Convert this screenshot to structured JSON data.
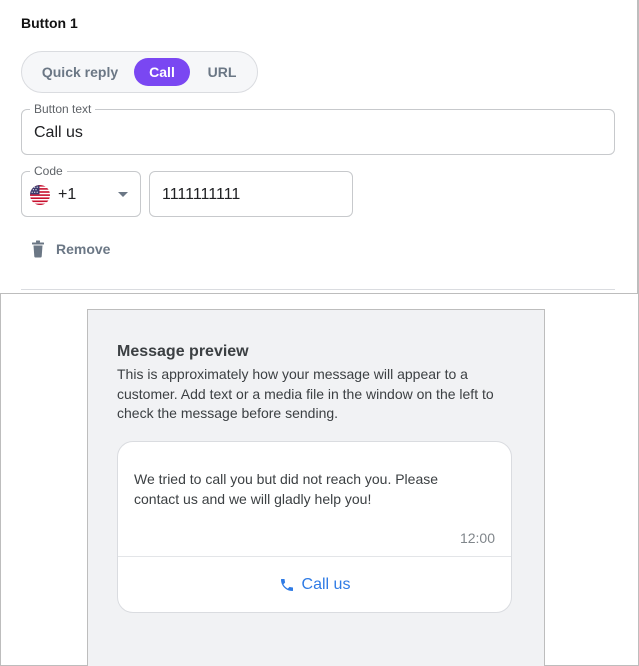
{
  "editor": {
    "section_title": "Button 1",
    "button_types": [
      {
        "label": "Quick reply",
        "selected": false
      },
      {
        "label": "Call",
        "selected": true
      },
      {
        "label": "URL",
        "selected": false
      }
    ],
    "button_text": {
      "label": "Button text",
      "value": "Call us"
    },
    "code": {
      "label": "Code",
      "value": "+1",
      "flag_icon": "us-flag-icon"
    },
    "phone": {
      "value": "1111111111"
    },
    "remove_label": "Remove",
    "accent_color": "#7a47f2"
  },
  "preview": {
    "title": "Message preview",
    "description": "This is approximately how your message will appear to a customer. Add text or a media file in the window on the left to check the message before sending.",
    "message": {
      "text": "We tried to call you but did not reach you. Please contact us and we will gladly help you!",
      "time": "12:00",
      "action_label": "Call us",
      "action_icon": "phone-icon",
      "action_color": "#2f7be5"
    }
  }
}
